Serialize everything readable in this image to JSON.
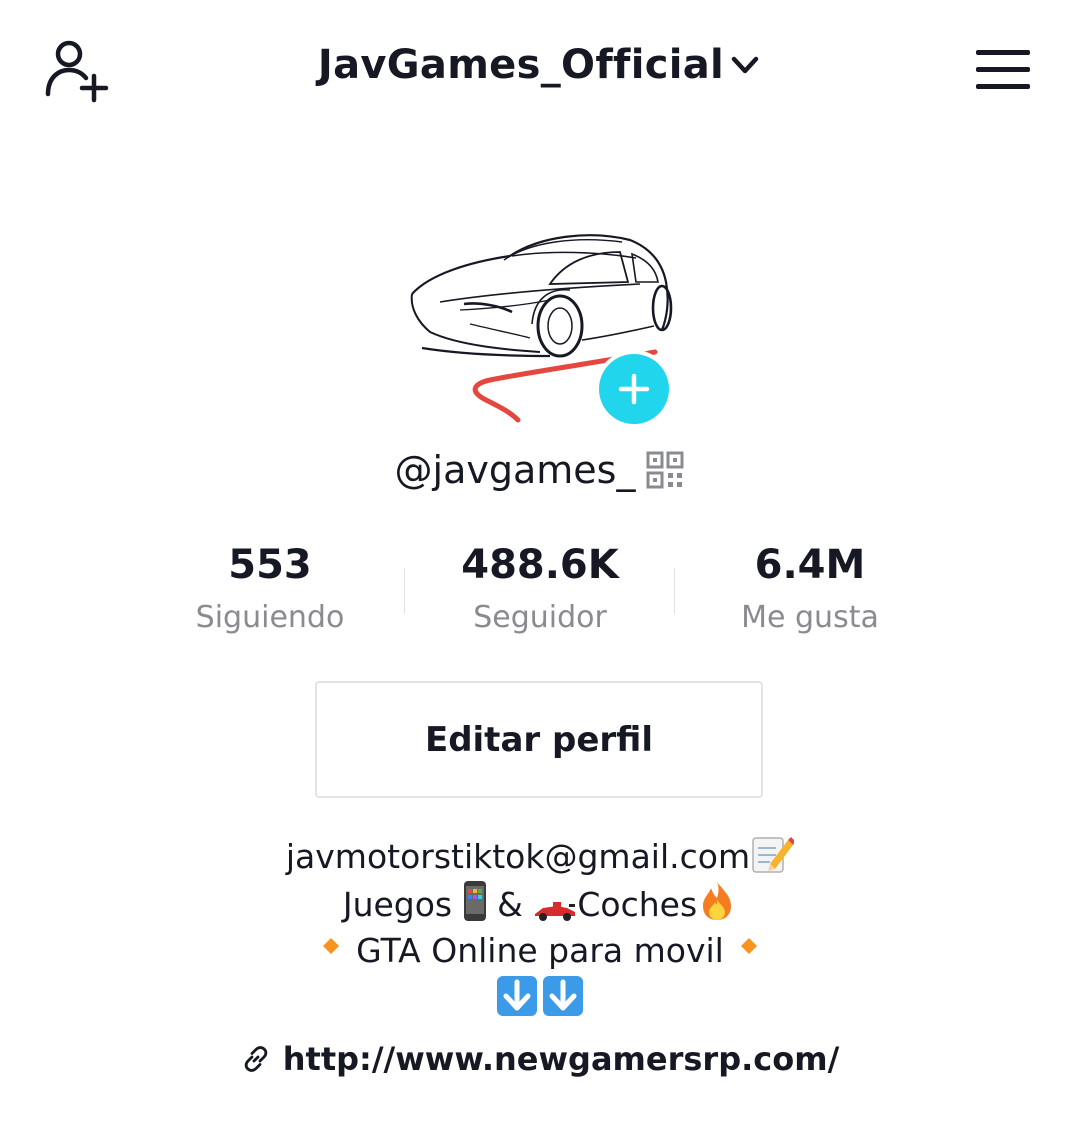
{
  "header": {
    "username_title": "JavGames_Official",
    "add_user_icon": "person-add-icon",
    "switch_account_icon": "chevron-down-icon",
    "menu_icon": "hamburger-menu-icon"
  },
  "profile": {
    "avatar_description": "car-sketch-avatar",
    "handle": "@javgames_",
    "qr_icon": "qr-code-icon"
  },
  "stats": [
    {
      "value": "553",
      "label": "Siguiendo"
    },
    {
      "value": "488.6K",
      "label": "Seguidor"
    },
    {
      "value": "6.4M",
      "label": "Me gusta"
    }
  ],
  "edit_button_label": "Editar perfil",
  "bio": {
    "line1_text": "javmotorstiktok@gmail.com",
    "line2_part1": "Juegos",
    "line2_part2": "&",
    "line2_part3": "Coches",
    "line3_text": "GTA Online para movil"
  },
  "link": {
    "url": "http://www.newgamersrp.com/",
    "icon": "link-icon"
  },
  "colors": {
    "accent": "#20d5ec",
    "text_primary": "#161823",
    "text_secondary": "#8a8b91",
    "border": "#e3e3e4"
  }
}
